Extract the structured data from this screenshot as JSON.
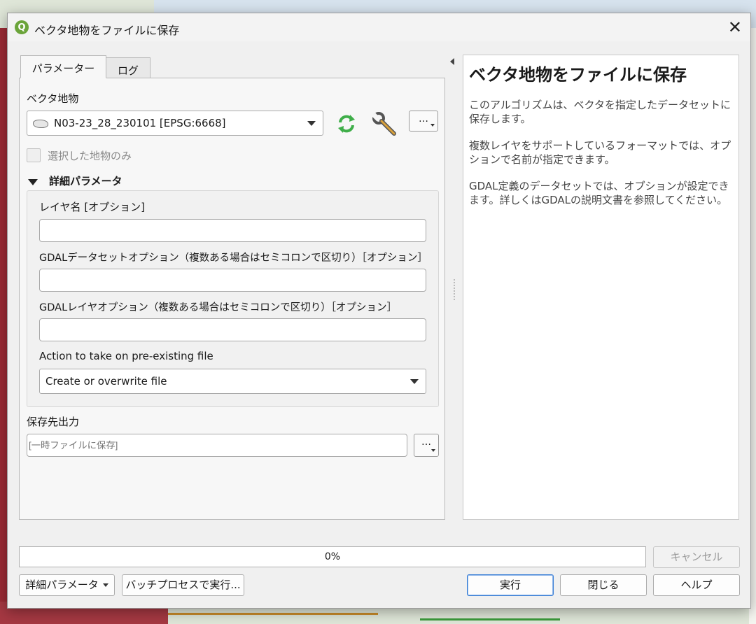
{
  "window": {
    "title": "ベクタ地物をファイルに保存",
    "close_glyph": "✕",
    "logo_letter": "Q"
  },
  "tabs": [
    {
      "label": "パラメーター",
      "active": true
    },
    {
      "label": "ログ",
      "active": false
    }
  ],
  "params": {
    "vector_label": "ベクタ地物",
    "vector_value": "N03-23_28_230101 [EPSG:6668]",
    "selected_only_label": "選択した地物のみ",
    "advanced_label": "詳細パラメータ",
    "layer_name_label": "レイヤ名 [オプション]",
    "layer_name_value": "",
    "gdal_dataset_label": "GDALデータセットオプション（複数ある場合はセミコロンで区切り）［オプション］",
    "gdal_dataset_value": "",
    "gdal_layer_label": "GDALレイヤオプション（複数ある場合はセミコロンで区切り）［オプション］",
    "gdal_layer_value": "",
    "action_label": "Action to take on pre-existing file",
    "action_value": "Create or overwrite file",
    "output_label": "保存先出力",
    "output_placeholder": "[一時ファイルに保存]",
    "ellipsis": "…"
  },
  "icons": {
    "iterate": "iterate-icon",
    "settings": "wrench-icon",
    "layer": "polygon-layer-icon"
  },
  "help": {
    "title": "ベクタ地物をファイルに保存",
    "paragraphs": [
      "このアルゴリズムは、ベクタを指定したデータセットに保存します。",
      "複数レイヤをサポートしているフォーマットでは、オプションで名前が指定できます。",
      "GDAL定義のデータセットでは、オプションが設定できます。詳しくはGDALの説明文書を参照してください。"
    ]
  },
  "footer": {
    "progress_text": "0%",
    "progress_value": 0,
    "cancel": "キャンセル",
    "advanced": "詳細パラメータ",
    "batch": "バッチプロセスで実行...",
    "run": "実行",
    "close": "閉じる",
    "help": "ヘルプ"
  },
  "colors": {
    "qgis_green": "#6ba43a",
    "iterate_green": "#3fae49",
    "primary_border": "#3a7fd5"
  }
}
